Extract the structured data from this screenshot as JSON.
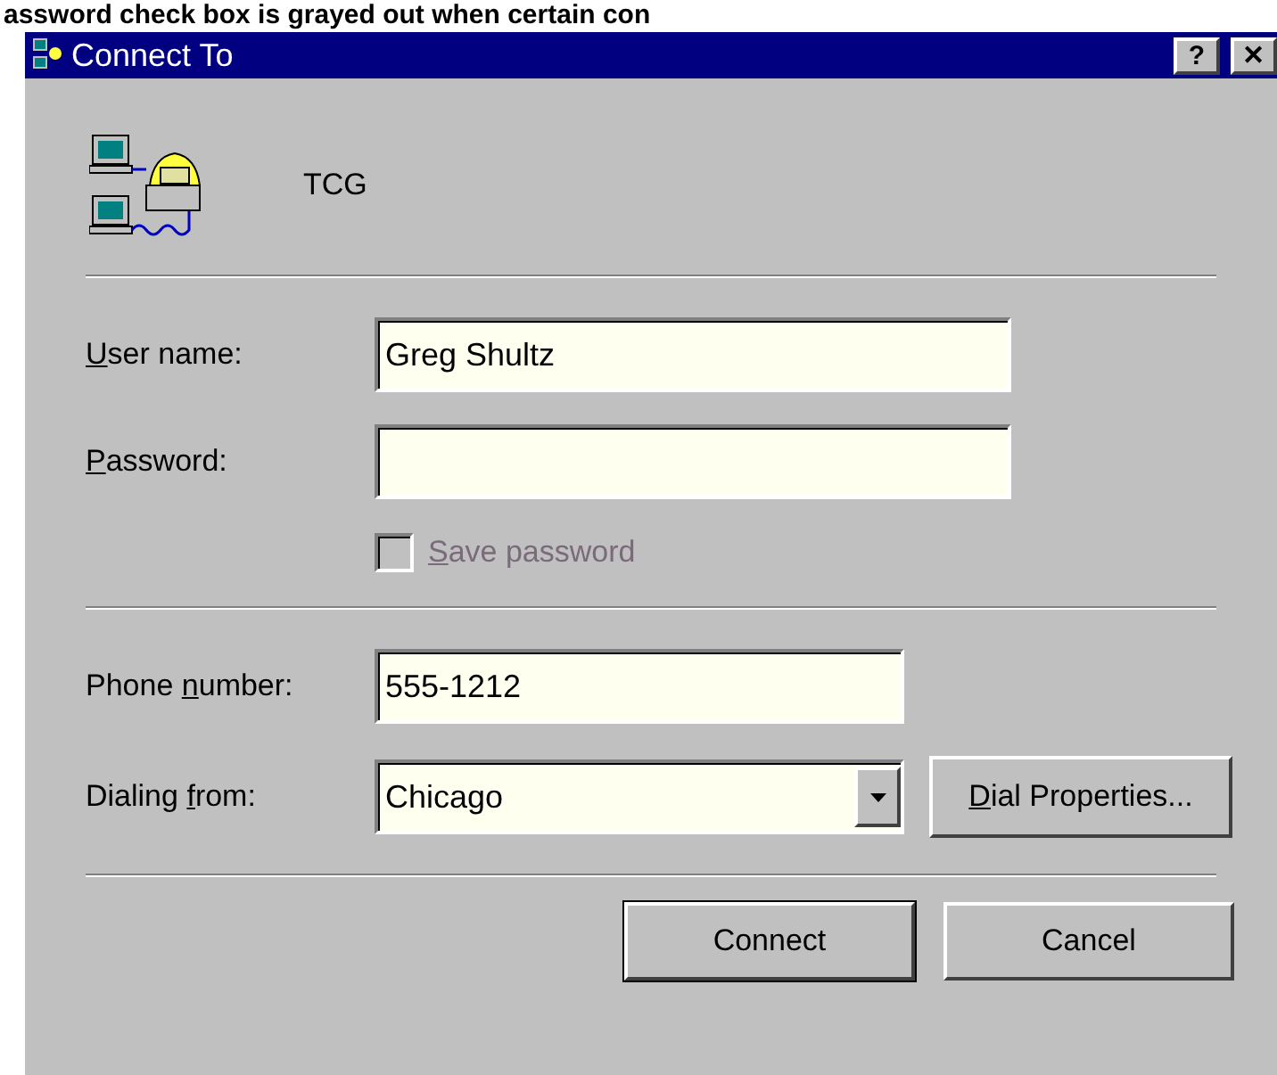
{
  "caption": "assword check box is grayed out when certain con",
  "window": {
    "title": "Connect To"
  },
  "title_buttons": [
    {
      "kind": "help",
      "label": "?"
    },
    {
      "kind": "close",
      "label": "✕"
    }
  ],
  "connection": {
    "name": "TCG"
  },
  "user_name": {
    "label": [
      {
        "text": "U",
        "underlined": true
      },
      {
        "text": "ser name:",
        "underlined": false
      }
    ],
    "value": "Greg Shultz"
  },
  "password": {
    "label": [
      {
        "text": "P",
        "underlined": true
      },
      {
        "text": "assword:",
        "underlined": false
      }
    ]
  },
  "save_password": {
    "label": [
      {
        "text": "S",
        "underlined": true
      },
      {
        "text": "ave password",
        "underlined": false
      }
    ],
    "checked": false,
    "disabled": true
  },
  "phone_number": {
    "label": [
      {
        "text": "Phone ",
        "underlined": false
      },
      {
        "text": "n",
        "underlined": true
      },
      {
        "text": "umber:",
        "underlined": false
      }
    ],
    "value": "555-1212"
  },
  "dialing_from": {
    "label": [
      {
        "text": "Dialing ",
        "underlined": false
      },
      {
        "text": "f",
        "underlined": true
      },
      {
        "text": "rom:",
        "underlined": false
      }
    ],
    "value": "Chicago"
  },
  "dial_properties": {
    "label": [
      {
        "text": "D",
        "underlined": true
      },
      {
        "text": "ial Properties...",
        "underlined": false
      }
    ]
  },
  "buttons": [
    {
      "label": "Connect",
      "default": true
    },
    {
      "label": "Cancel",
      "default": false
    }
  ]
}
